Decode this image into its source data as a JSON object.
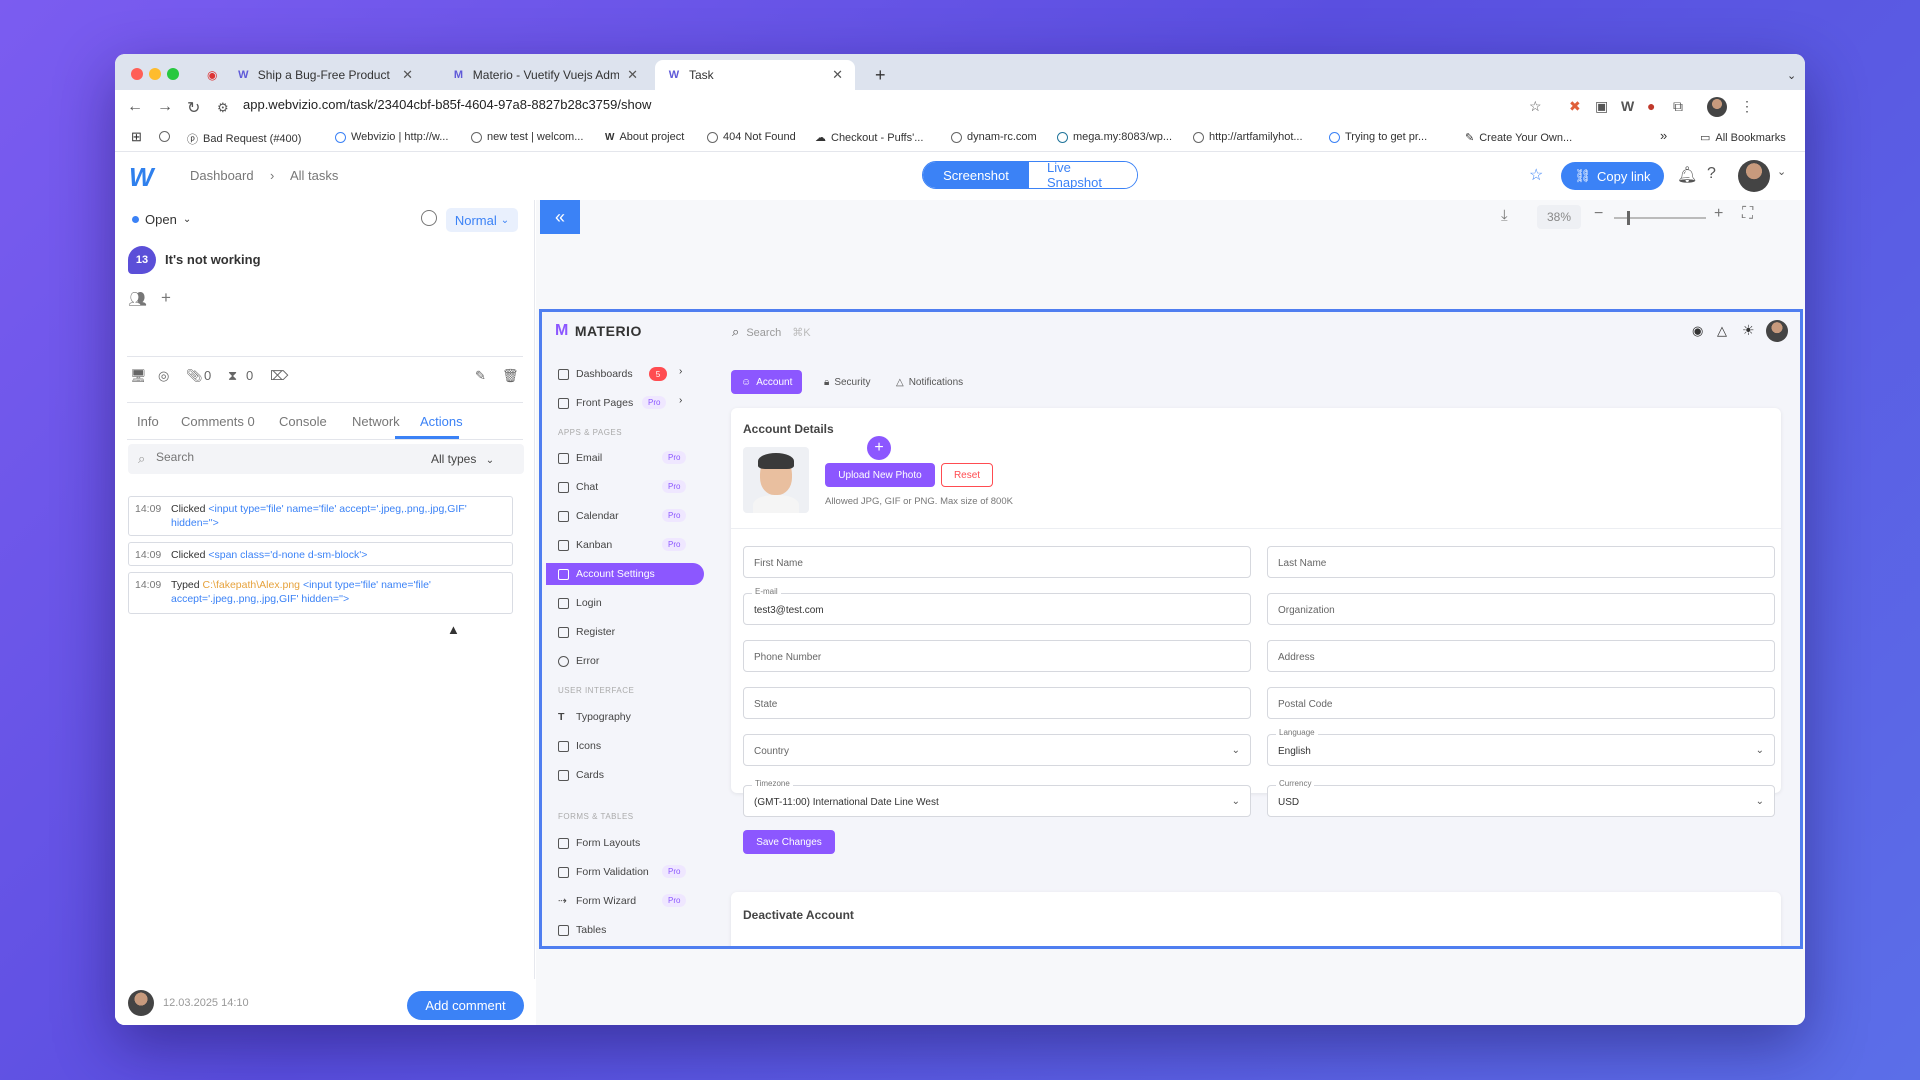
{
  "browser": {
    "tabs": [
      {
        "label": "Ship a Bug-Free Product Fast",
        "icon": "W"
      },
      {
        "label": "Materio - Vuetify Vuejs Admin",
        "icon": "M"
      },
      {
        "label": "Task",
        "icon": "W"
      }
    ],
    "url": "app.webvizio.com/task/23404cbf-b85f-4604-97a8-8827b28c3759/show",
    "bookmarks": [
      "Bad Request (#400)",
      "Webvizio | http://w...",
      "new test | welcom...",
      "About project",
      "404 Not Found",
      "Checkout - Puffs'...",
      "dynam-rc.com",
      "mega.my:8083/wp...",
      "http://artfamilyhot...",
      "Trying to get pr...",
      "Create Your Own..."
    ],
    "all_bookmarks": "All Bookmarks"
  },
  "header": {
    "breadcrumb": [
      "Dashboard",
      "All tasks"
    ],
    "view_tabs": {
      "screenshot": "Screenshot",
      "live": "Live Snapshot"
    },
    "copy_link": "Copy link"
  },
  "task": {
    "status": "Open",
    "priority": "Normal",
    "number": "13",
    "title": "It's not working",
    "attachments_count": "0",
    "time_count": "0",
    "tabs": [
      "Info",
      "Comments 0",
      "Console",
      "Network",
      "Actions"
    ],
    "search_placeholder": "Search",
    "filter": "All types",
    "actions": [
      {
        "time": "14:09",
        "verb": "Clicked",
        "code": "<input type='file' name='file' accept='.jpeg,.png,.jpg,GIF' hidden=''>",
        "path": ""
      },
      {
        "time": "14:09",
        "verb": "Clicked",
        "code": "<span class='d-none d-sm-block'>",
        "path": ""
      },
      {
        "time": "14:09",
        "verb": "Typed",
        "code": "<input type='file' name='file' accept='.jpeg,.png,.jpg,GIF' hidden=''>",
        "path": "C:\\fakepath\\Alex.png"
      }
    ],
    "footer_date": "12.03.2025 14:10",
    "add_comment": "Add comment"
  },
  "viewer": {
    "zoom": "38%"
  },
  "materio": {
    "brand": "MATERIO",
    "search": "Search",
    "search_shortcut": "⌘K",
    "nav": {
      "dashboards": "Dashboards",
      "dashboards_badge": "5",
      "front_pages": "Front Pages",
      "section_apps": "APPS & PAGES",
      "email": "Email",
      "chat": "Chat",
      "calendar": "Calendar",
      "kanban": "Kanban",
      "account_settings": "Account Settings",
      "login": "Login",
      "register": "Register",
      "error": "Error",
      "section_ui": "USER INTERFACE",
      "typography": "Typography",
      "icons": "Icons",
      "cards": "Cards",
      "section_forms": "FORMS & TABLES",
      "form_layouts": "Form Layouts",
      "form_validation": "Form Validation",
      "form_wizard": "Form Wizard",
      "tables": "Tables",
      "pro": "Pro"
    },
    "tabs": [
      "Account",
      "Security",
      "Notifications"
    ],
    "account_details": "Account Details",
    "upload_photo": "Upload New Photo",
    "reset": "Reset",
    "photo_hint": "Allowed JPG, GIF or PNG. Max size of 800K",
    "fields": {
      "first_name": "First Name",
      "last_name": "Last Name",
      "email_label": "E-mail",
      "email_value": "test3@test.com",
      "organization": "Organization",
      "phone": "Phone Number",
      "address": "Address",
      "state": "State",
      "postal": "Postal Code",
      "country": "Country",
      "language_label": "Language",
      "language_value": "English",
      "timezone_label": "Timezone",
      "timezone_value": "(GMT-11:00) International Date Line West",
      "currency_label": "Currency",
      "currency_value": "USD"
    },
    "save": "Save Changes",
    "deactivate": "Deactivate Account"
  }
}
